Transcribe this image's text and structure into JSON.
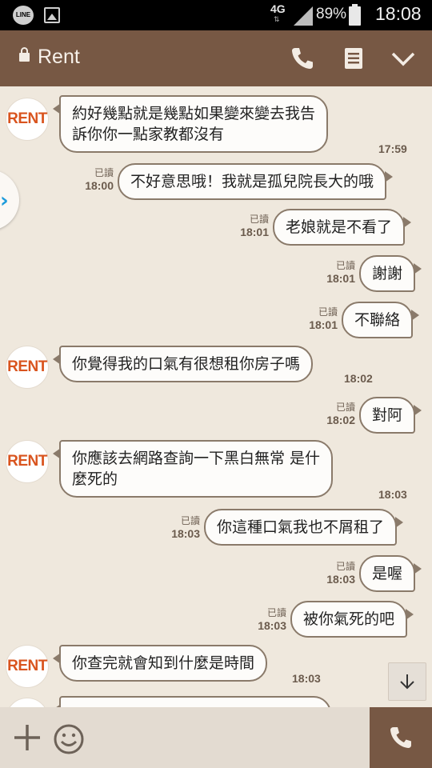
{
  "status_bar": {
    "app_icon": "LINE",
    "network": "4G",
    "battery": "89%",
    "time": "18:08"
  },
  "header": {
    "title": "Rent",
    "icons": [
      "lock-icon",
      "phone-icon",
      "note-icon",
      "chevron-down-icon"
    ]
  },
  "contact": {
    "avatar_text": "RENT"
  },
  "messages": [
    {
      "dir": "in",
      "text_line1": "約好幾點就是幾點如果變來變去我告",
      "text_line2": "訴你你一點家教都沒有",
      "time": "17:59"
    },
    {
      "dir": "out",
      "text": "不好意思哦！我就是孤兒院長大的哦",
      "read": "已讀",
      "time": "18:00"
    },
    {
      "dir": "out",
      "text": "老娘就是不看了",
      "read": "已讀",
      "time": "18:01"
    },
    {
      "dir": "out",
      "text": "謝謝",
      "read": "已讀",
      "time": "18:01"
    },
    {
      "dir": "out",
      "text": "不聯絡",
      "read": "已讀",
      "time": "18:01"
    },
    {
      "dir": "in",
      "text": "你覺得我的口氣有很想租你房子嗎",
      "time": "18:02"
    },
    {
      "dir": "out",
      "text": "對阿",
      "read": "已讀",
      "time": "18:02"
    },
    {
      "dir": "in",
      "text_line1": "你應該去網路查詢一下黑白無常 是什",
      "text_line2": "麼死的",
      "time": "18:03"
    },
    {
      "dir": "out",
      "text": "你這種口氣我也不屑租了",
      "read": "已讀",
      "time": "18:03"
    },
    {
      "dir": "out",
      "text": "是喔",
      "read": "已讀",
      "time": "18:03"
    },
    {
      "dir": "out",
      "text": "被你氣死的吧",
      "read": "已讀",
      "time": "18:03"
    },
    {
      "dir": "in",
      "text": "你查完就會知到什麼是時間",
      "time": "18:03"
    }
  ],
  "footer": {
    "icons": [
      "plus-icon",
      "smile-icon",
      "phone-icon"
    ]
  }
}
